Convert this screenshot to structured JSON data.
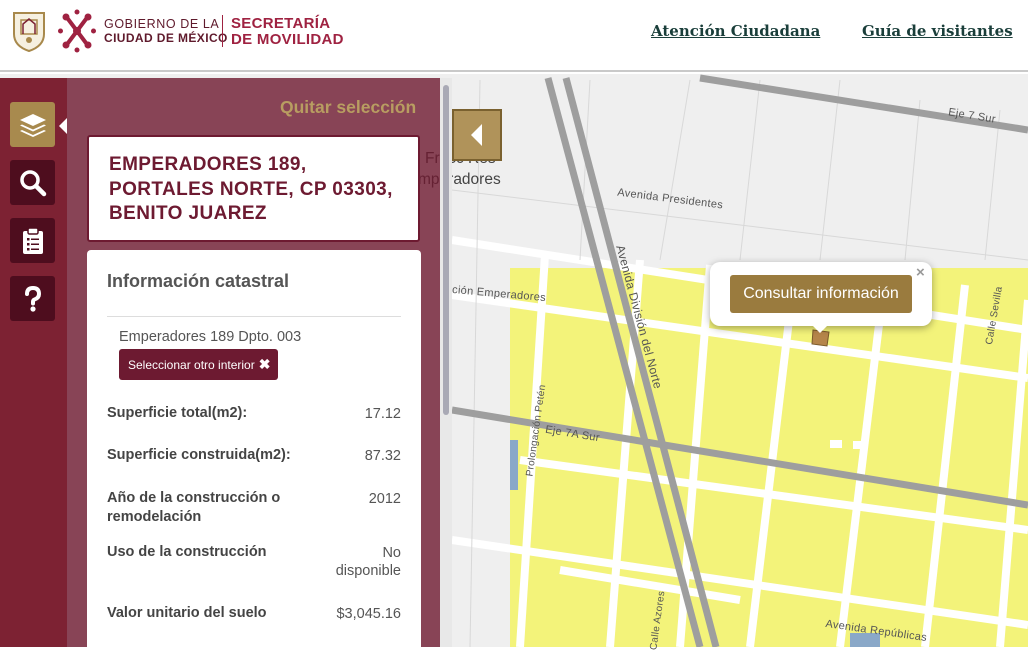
{
  "header": {
    "gobierno_line1": "GOBIERNO DE LA",
    "gobierno_line2": "CIUDAD DE MÉXICO",
    "secretaria_line1": "SECRETARÍA",
    "secretaria_line2": "DE MOVILIDAD",
    "nav": [
      "Atención Ciudadana",
      "Guía de visitantes"
    ]
  },
  "sidebar": {
    "buttons": [
      {
        "icon": "layers-icon",
        "active": true
      },
      {
        "icon": "search-icon",
        "active": false
      },
      {
        "icon": "clipboard-icon",
        "active": false
      },
      {
        "icon": "help-icon",
        "active": false
      }
    ]
  },
  "panel": {
    "quitar_label": "Quitar selección",
    "address_lines": [
      "EMPERADORES 189,",
      "PORTALES NORTE, CP 03303,",
      "BENITO JUAREZ"
    ],
    "info_title": "Información catastral",
    "unit_label": "Emperadores 189 Dpto. 003",
    "select_other_label": "Seleccionar otro interior",
    "rows": [
      {
        "label": "Superficie total(m2):",
        "value": "17.12"
      },
      {
        "label": "Superficie construida(m2):",
        "value": "87.32"
      },
      {
        "label": "Año de la construcción o remodelación",
        "value": "2012"
      },
      {
        "label": "Uso de la construcción",
        "value": "No disponible"
      },
      {
        "label": "Valor unitario del suelo",
        "value": "$3,045.16"
      }
    ]
  },
  "map": {
    "popup_button": "Consultar información",
    "popup_close": "×",
    "labels": {
      "fracc_line1": "Fracc Res",
      "fracc_line2": "mperadores",
      "avenida_presidentes": "Avenida Presidentes",
      "avenida_division": "Avenida División del Norte",
      "eje7sur": "Eje 7 Sur",
      "eje7asur": "Eje 7A Sur",
      "prolongacion_peten": "Prolongación Petén",
      "calle_sevilla": "Calle Sevilla",
      "avenida_republicas": "Avenida Repúblicas",
      "cion_emperadores": "ción Emperadores",
      "calle_azores": "Calle Azores"
    },
    "colors": {
      "blocks": "#f3f37a",
      "roads": "#ffffff",
      "major_road": "#9e9e9e",
      "selected_parcel": "#b5854a"
    }
  }
}
